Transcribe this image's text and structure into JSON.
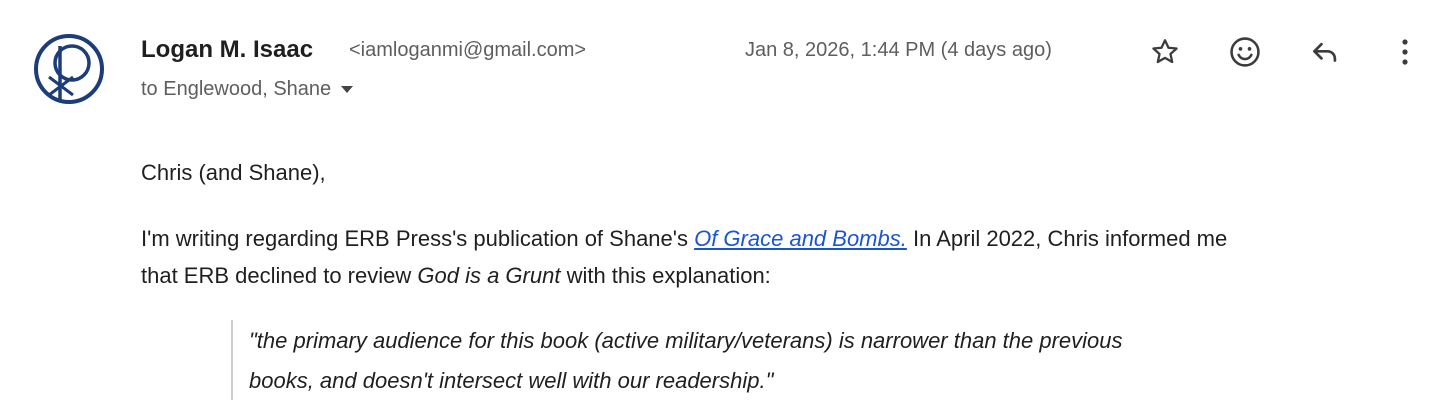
{
  "sender": {
    "name": "Logan M. Isaac",
    "email": "<iamloganmi@gmail.com>"
  },
  "recipients": "to Englewood, Shane",
  "date": "Jan 8, 2026, 1:44 PM (4 days ago)",
  "icons": {
    "star": "star-icon",
    "emoji": "emoji-icon",
    "reply": "reply-icon",
    "more": "more-vert-icon"
  },
  "colors": {
    "avatar": "#1c3d7a",
    "link": "#1a55d0",
    "muted": "#5e5e5e"
  },
  "body": {
    "greeting": "Chris (and Shane),",
    "p1": {
      "before": "I'm writing regarding ERB Press's publication of Shane's ",
      "link": "Of Grace and Bombs.",
      "after": " In April 2022, Chris informed me"
    },
    "p2": {
      "before": "that ERB declined to review ",
      "title": "God is a Grunt",
      "after": " with this explanation:"
    },
    "quote": {
      "line1": "\"the primary audience for this book (active military/veterans) is narrower than the previous",
      "line2": "books, and doesn't intersect well with our readership.\""
    }
  }
}
